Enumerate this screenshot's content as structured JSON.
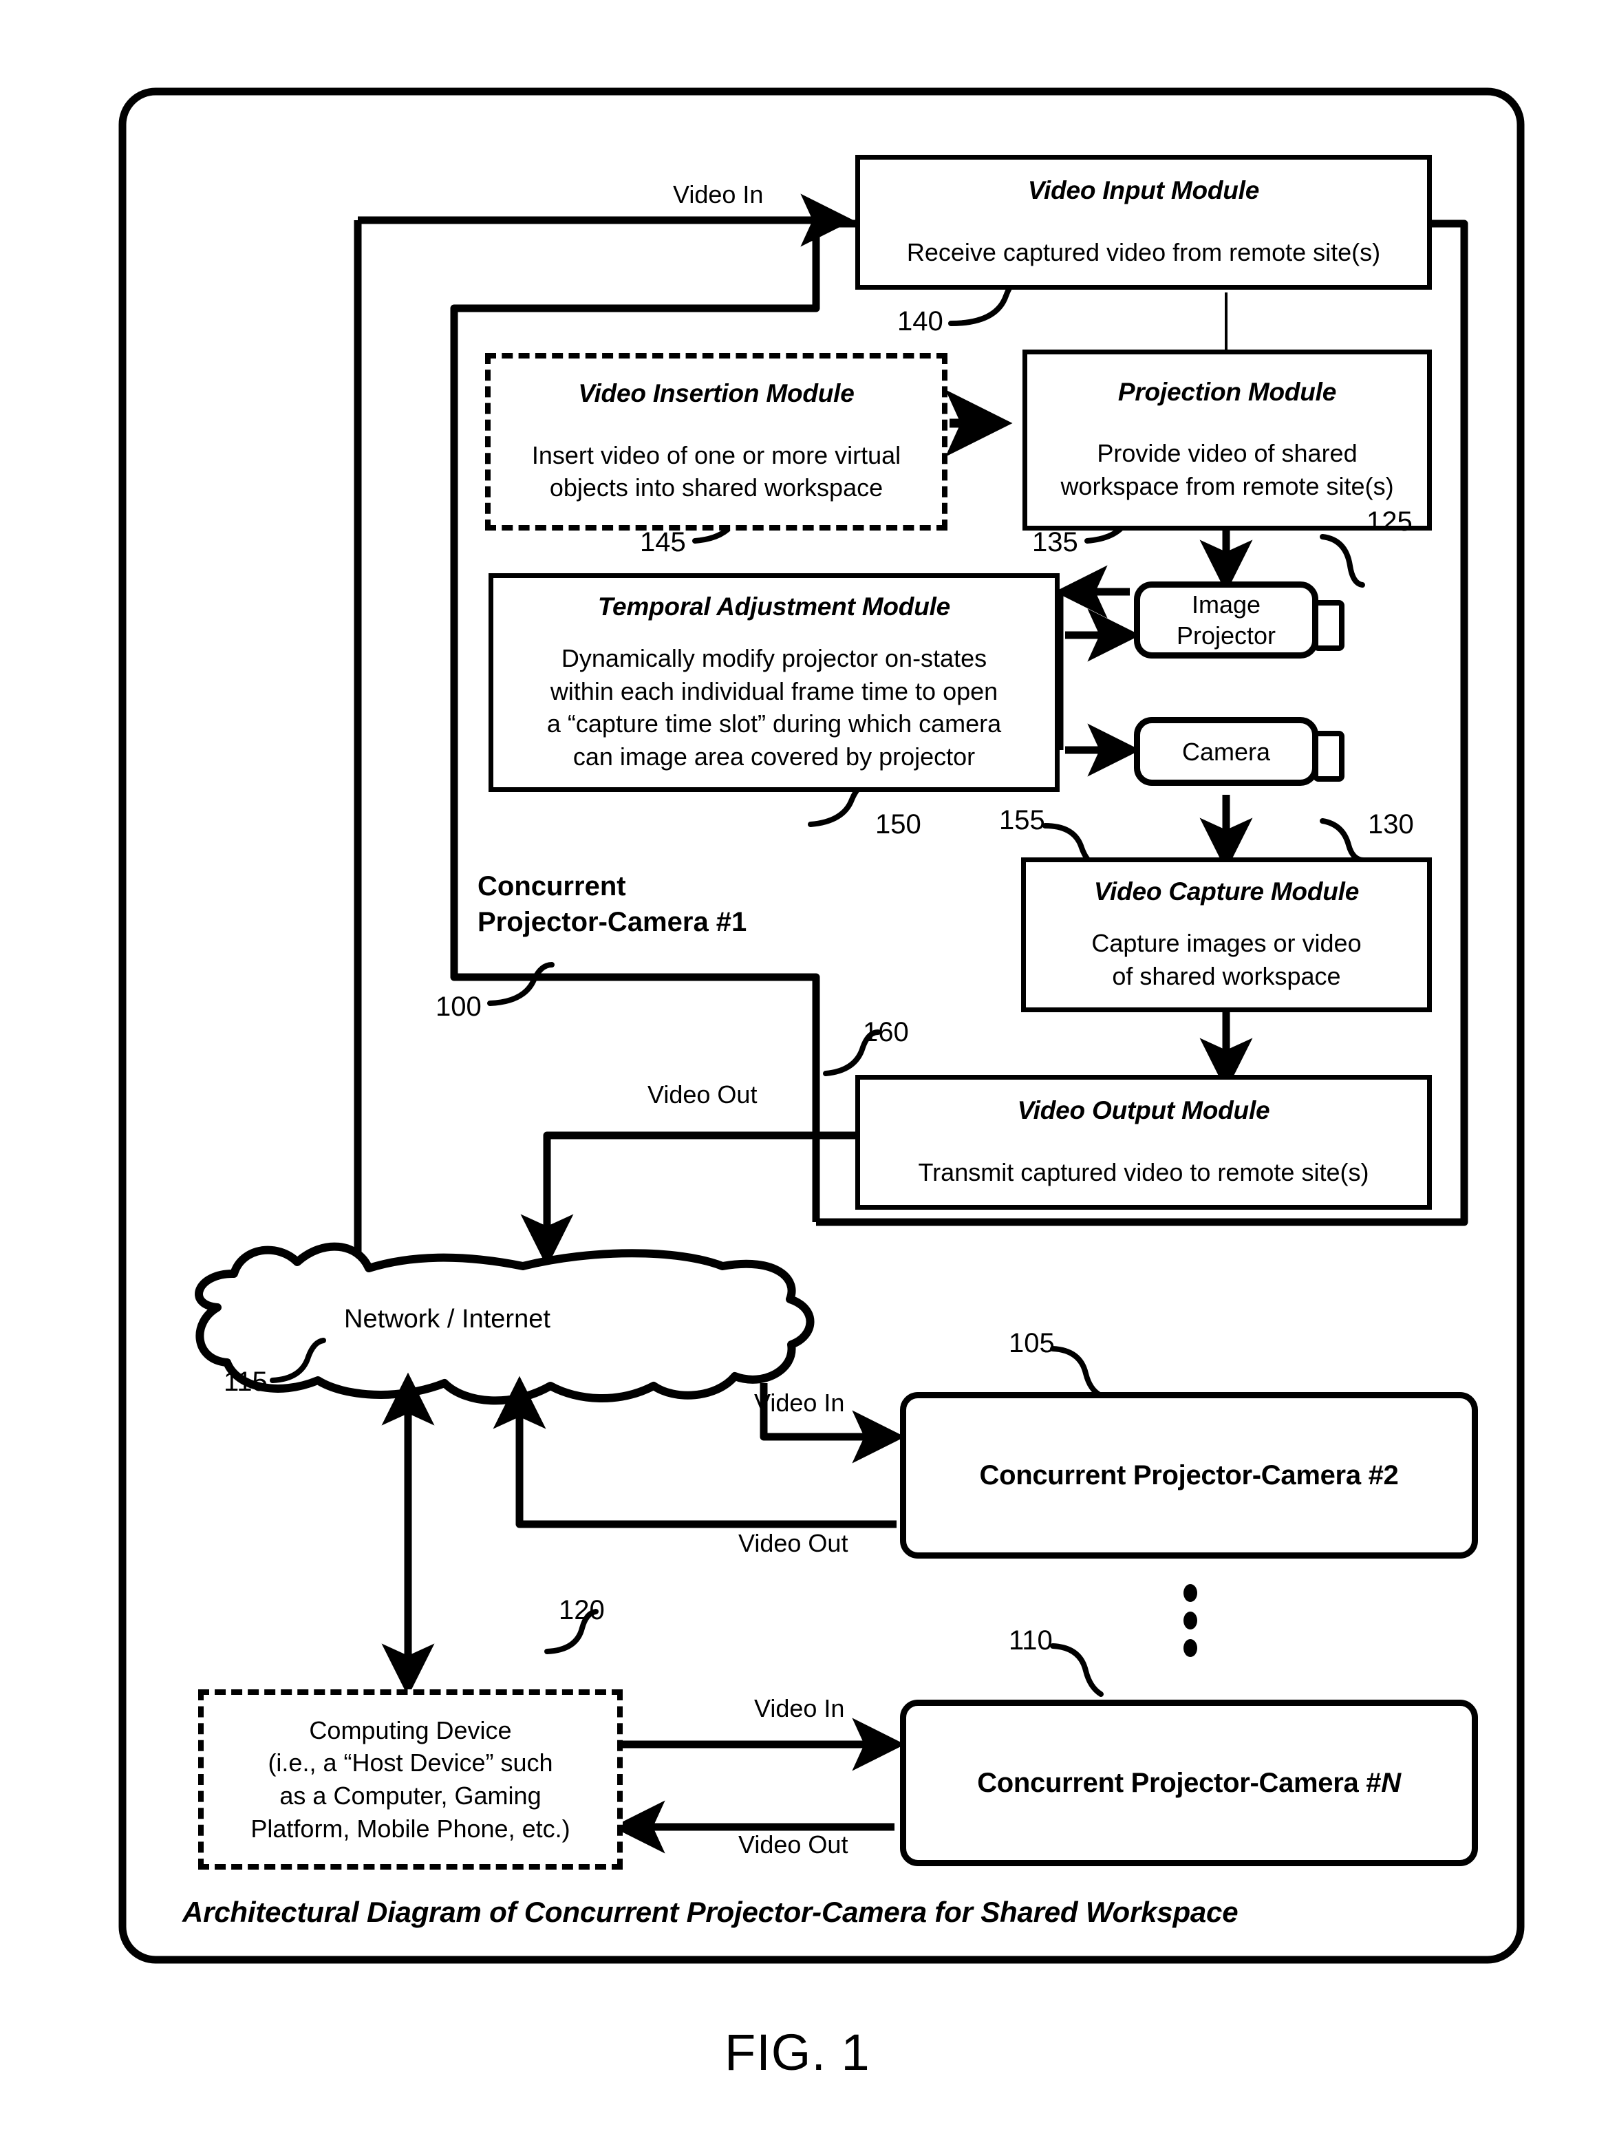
{
  "figure": {
    "caption": "Architectural Diagram of Concurrent Projector-Camera for Shared Workspace",
    "fig_label": "FIG. 1"
  },
  "modules": {
    "video_input": {
      "title": "Video Input Module",
      "body": "Receive captured video from remote site(s)",
      "ref": "140"
    },
    "video_insertion": {
      "title": "Video Insertion Module",
      "body_line1": "Insert video of one or more virtual",
      "body_line2": "objects into shared workspace",
      "ref": "145"
    },
    "projection": {
      "title": "Projection Module",
      "body_line1": "Provide video of shared",
      "body_line2": "workspace from remote site(s)",
      "ref": "135"
    },
    "temporal": {
      "title": "Temporal Adjustment Module",
      "body_line1": "Dynamically modify projector on-states",
      "body_line2": "within each individual frame time to open",
      "body_line3": "a “capture time slot” during which camera",
      "body_line4": "can image area covered by projector",
      "ref": "150"
    },
    "video_capture": {
      "title": "Video Capture Module",
      "body_line1": "Capture images or video",
      "body_line2": "of shared workspace",
      "ref": "155"
    },
    "video_output": {
      "title": "Video Output Module",
      "body": "Transmit captured video to remote site(s)",
      "ref": "160"
    }
  },
  "devices": {
    "projector": {
      "line1": "Image",
      "line2": "Projector",
      "ref": "125"
    },
    "camera": {
      "line1": "Camera",
      "ref": "130"
    }
  },
  "groups": {
    "unit1": {
      "line1": "Concurrent",
      "line2": "Projector-Camera #1",
      "ref": "100"
    }
  },
  "network": {
    "label": "Network / Internet",
    "ref": "115"
  },
  "peers": {
    "peer2": {
      "label": "Concurrent Projector-Camera #2",
      "ref": "105"
    },
    "peerN_prefix": "Concurrent Projector-Camera #",
    "peerN_suffix": "N",
    "peerN_ref": "110"
  },
  "host": {
    "line1": "Computing Device",
    "line2": "(i.e., a “Host Device” such",
    "line3": "as a Computer, Gaming",
    "line4": "Platform, Mobile Phone, etc.)",
    "ref": "120"
  },
  "edge_labels": {
    "video_in_top": "Video In",
    "video_out_mid": "Video Out",
    "video_in_peer2": "Video In",
    "video_out_peer2": "Video Out",
    "video_in_peerN": "Video In",
    "video_out_peerN": "Video Out"
  },
  "colors": {
    "ink": "#000000",
    "paper": "#ffffff"
  }
}
